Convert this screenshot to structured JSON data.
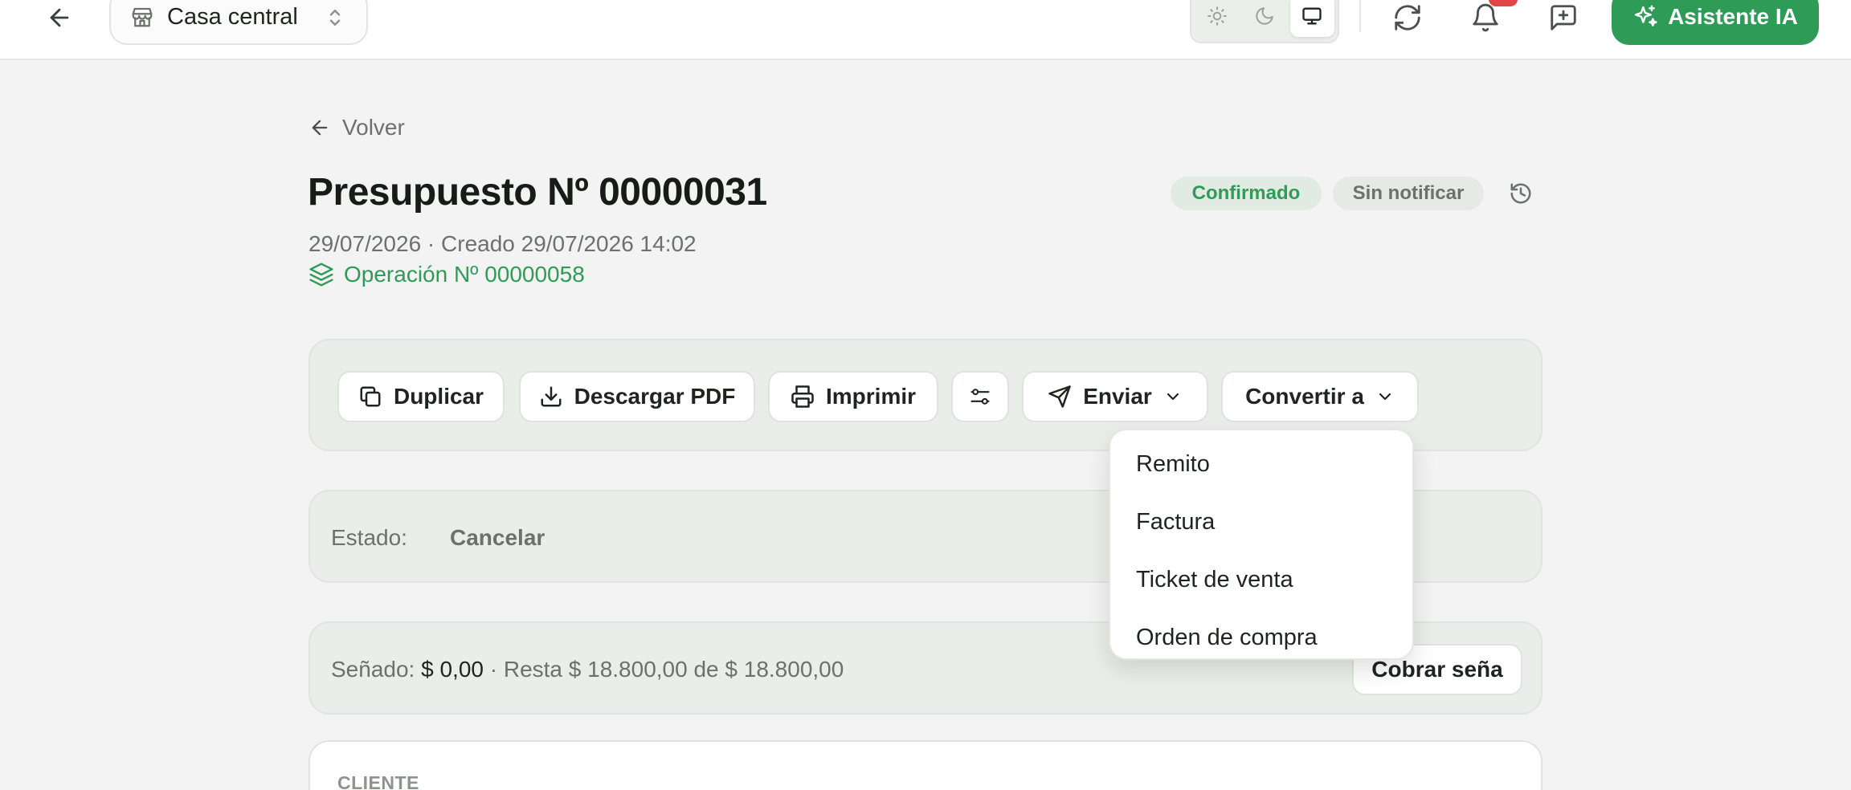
{
  "topbar": {
    "branch": "Casa central",
    "assistant_label": "Asistente IA"
  },
  "header": {
    "back_label": "Volver",
    "title": "Presupuesto Nº 00000031",
    "date_line": "29/07/2026 · Creado 29/07/2026 14:02",
    "operation_link": "Operación Nº 00000058",
    "badges": {
      "status": "Confirmado",
      "notification": "Sin notificar"
    }
  },
  "toolbar": {
    "duplicate": "Duplicar",
    "download_pdf": "Descargar PDF",
    "print": "Imprimir",
    "send": "Enviar",
    "convert": "Convertir a"
  },
  "convert_menu": {
    "items": [
      "Remito",
      "Factura",
      "Ticket de venta",
      "Orden de compra"
    ]
  },
  "status": {
    "label": "Estado:",
    "cancel": "Cancelar"
  },
  "deposit": {
    "label": "Señado:",
    "amount": "$ 0,00",
    "remaining": " · Resta $ 18.800,00 de $ 18.800,00",
    "charge_button": "Cobrar seña"
  },
  "client": {
    "label": "CLIENTE"
  },
  "colors": {
    "accent": "#2e9b57",
    "notification_badge": "#e04646"
  }
}
